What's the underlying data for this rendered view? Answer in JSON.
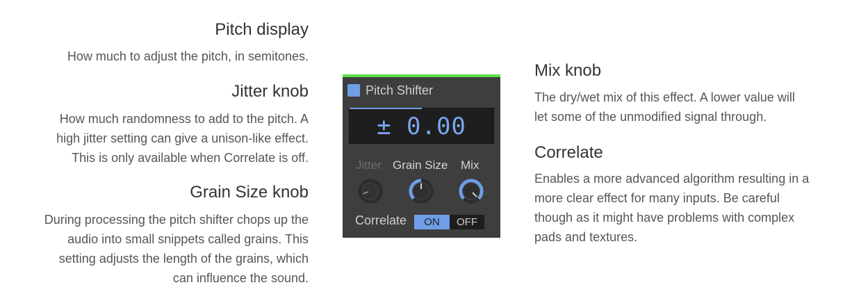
{
  "left": {
    "pitch": {
      "heading": "Pitch display",
      "desc": "How much to adjust the pitch, in semitones."
    },
    "jitter": {
      "heading": "Jitter knob",
      "desc_lines": [
        "How much randomness to add to the pitch. A",
        "high jitter setting can give a unison-like effect.",
        "This is only available when Correlate is off."
      ]
    },
    "grain": {
      "heading": "Grain Size knob",
      "desc_lines": [
        "During processing the pitch shifter chops up the",
        "audio into small snippets called grains. This",
        "setting adjusts the length of the grains, which",
        "can influence the sound."
      ]
    }
  },
  "right": {
    "mix": {
      "heading": "Mix knob",
      "desc_lines": [
        "The dry/wet mix of this effect. A lower value will",
        "let some of the unmodified signal through."
      ]
    },
    "correlate": {
      "heading": "Correlate",
      "desc_lines": [
        "Enables a more advanced algorithm resulting in a",
        "more clear effect for many inputs. Be careful",
        "though as it might have problems with complex",
        "pads and textures."
      ]
    }
  },
  "plugin": {
    "title": "Pitch Shifter",
    "display_value": "± 0.00",
    "knobs": {
      "jitter": {
        "label": "Jitter",
        "enabled": false,
        "value": 0.1
      },
      "grain_size": {
        "label": "Grain Size",
        "enabled": true,
        "value": 0.5
      },
      "mix": {
        "label": "Mix",
        "enabled": true,
        "value": 1.0
      }
    },
    "correlate_label": "Correlate",
    "toggle_on": "ON",
    "toggle_off": "OFF",
    "correlate_state": "ON",
    "colors": {
      "accent": "#6f9ee8",
      "panel_bg": "#3e3e3e",
      "top_strip": "#5fe04a",
      "display_bg": "#1e1e1e"
    }
  }
}
